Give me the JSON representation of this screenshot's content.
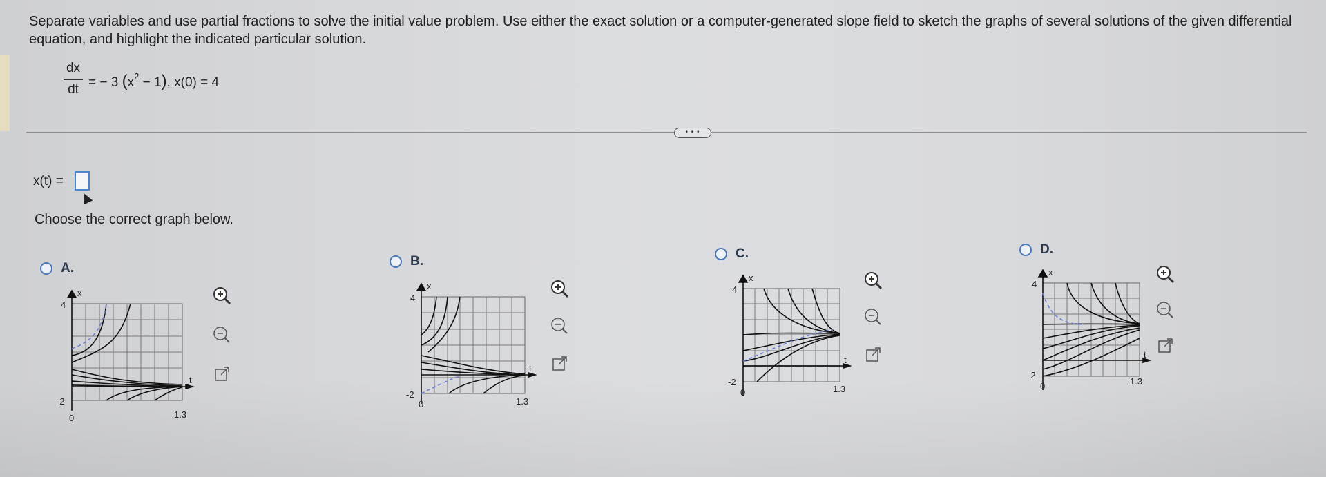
{
  "instructions": "Separate variables and use partial fractions to solve the initial value problem. Use either the exact solution or a computer-generated slope field to sketch the graphs of several solutions of the given differential equation, and highlight the indicated particular solution.",
  "equation": {
    "numerator": "dx",
    "denominator": "dt",
    "rhs_part1": "= − 3",
    "rhs_x": "x",
    "rhs_exponent": "2",
    "rhs_part2": " − 1",
    "rhs_condition": ", x(0) = 4"
  },
  "expand_label": "• • •",
  "answer": {
    "label": "x(t) =",
    "value": ""
  },
  "prompt": "Choose the correct graph below.",
  "options": [
    {
      "letter": "A.",
      "y_top": "4",
      "y_bottom": "-2",
      "x_start": "0",
      "x_end": "1.3",
      "x_axis": "t",
      "y_axis": "x"
    },
    {
      "letter": "B.",
      "y_top": "4",
      "y_bottom": "-2",
      "x_start": "0",
      "x_end": "1.3",
      "x_axis": "t",
      "y_axis": "x"
    },
    {
      "letter": "C.",
      "y_top": "4",
      "y_bottom": "-2",
      "x_start": "0",
      "x_end": "1.3",
      "x_axis": "t",
      "y_axis": "x"
    },
    {
      "letter": "D.",
      "y_top": "4",
      "y_bottom": "-2",
      "x_start": "0",
      "x_end": "1.3",
      "x_axis": "t",
      "y_axis": "x"
    }
  ],
  "icons": [
    "zoom-in-icon",
    "zoom-out-icon",
    "popout-icon",
    "radio-icon"
  ],
  "colors": {
    "accent": "#4a78b8",
    "curve": "#333333",
    "highlight": "#6f7fd0"
  }
}
